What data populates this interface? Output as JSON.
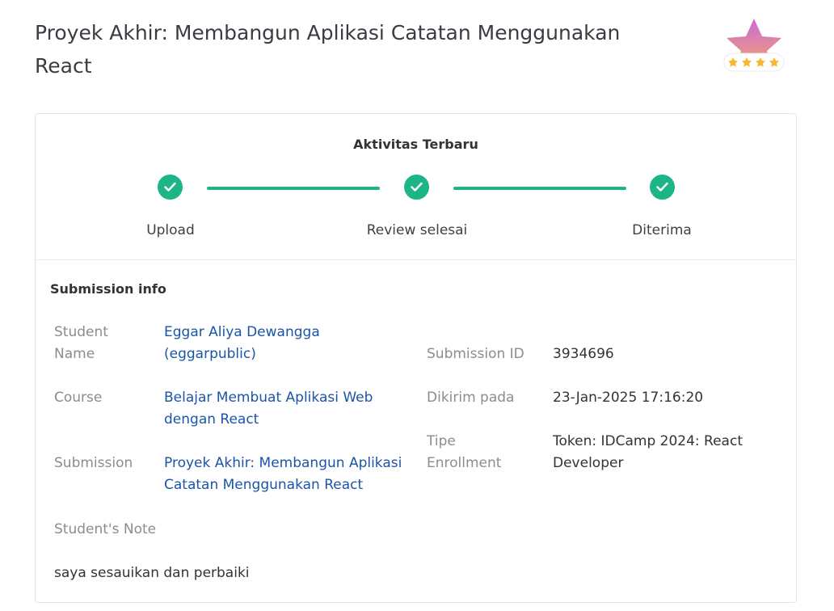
{
  "page": {
    "title": "Proyek Akhir: Membangun Aplikasi Catatan Menggunakan React"
  },
  "badge": {
    "icon": "star-rating-badge-icon",
    "stars": 4,
    "colors": {
      "top": "#c86dd7",
      "bottom": "#f5a26a",
      "star": "#f7b731"
    }
  },
  "activity": {
    "title": "Aktivitas Terbaru",
    "accent": "#1db588",
    "steps": [
      {
        "label": "Upload",
        "icon": "check-icon"
      },
      {
        "label": "Review selesai",
        "icon": "check-icon"
      },
      {
        "label": "Diterima",
        "icon": "check-icon"
      }
    ]
  },
  "submission": {
    "title": "Submission info",
    "student_name": {
      "label": "Student Name",
      "value": "Eggar Aliya Dewangga (eggarpublic)"
    },
    "course": {
      "label": "Course",
      "value": "Belajar Membuat Aplikasi Web dengan React"
    },
    "submission": {
      "label": "Submission",
      "value": "Proyek Akhir: Membangun Aplikasi Catatan Menggunakan React"
    },
    "submission_id": {
      "label": "Submission ID",
      "value": "3934696"
    },
    "sent_at": {
      "label": "Dikirim pada",
      "value": "23-Jan-2025 17:16:20"
    },
    "enrollment": {
      "label": "Tipe Enrollment",
      "value": "Token: IDCamp 2024: React Developer"
    },
    "note": {
      "label": "Student's Note",
      "value": "saya sesauikan dan perbaiki"
    }
  },
  "colors": {
    "link": "#1b55a8",
    "label": "#8b8b93",
    "text": "#333333"
  }
}
